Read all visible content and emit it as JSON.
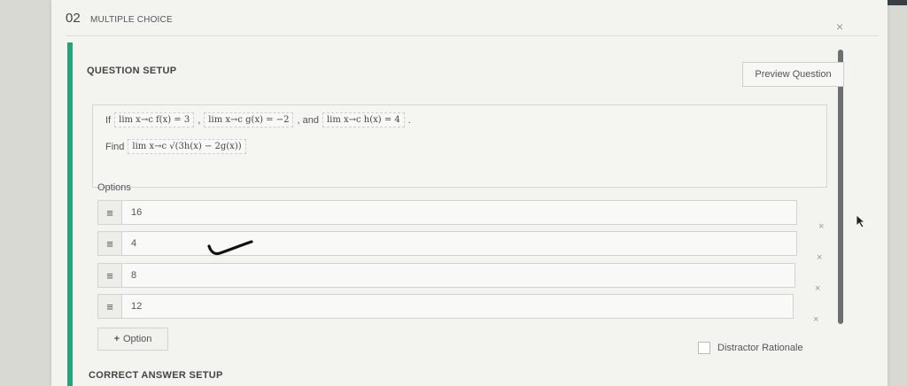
{
  "header": {
    "number": "02",
    "type_label": "MULTIPLE CHOICE",
    "close_glyph": "×"
  },
  "question_setup": {
    "title": "QUESTION SETUP",
    "preview_button": "Preview Question",
    "line1": {
      "prefix": "If",
      "expr1": "lim x→c f(x) = 3",
      "sep1": ",",
      "expr2": "lim x→c g(x) = −2",
      "sep2": ", and",
      "expr3": "lim x→c h(x) = 4",
      "suffix": "."
    },
    "line2": {
      "prefix": "Find",
      "expr": "lim x→c √(3h(x) − 2g(x))"
    }
  },
  "options": {
    "label": "Options",
    "handle_glyph": "≡",
    "remove_glyph": "×",
    "items": [
      {
        "value": "16"
      },
      {
        "value": "4"
      },
      {
        "value": "8"
      },
      {
        "value": "12"
      }
    ],
    "add_button_icon": "+",
    "add_button_label": "Option"
  },
  "distractor_rationale_label": "Distractor Rationale",
  "correct_answer_setup_title": "CORRECT ANSWER SETUP",
  "colors": {
    "accent_green": "#27a37b",
    "scrollbar": "#6b6f73"
  }
}
